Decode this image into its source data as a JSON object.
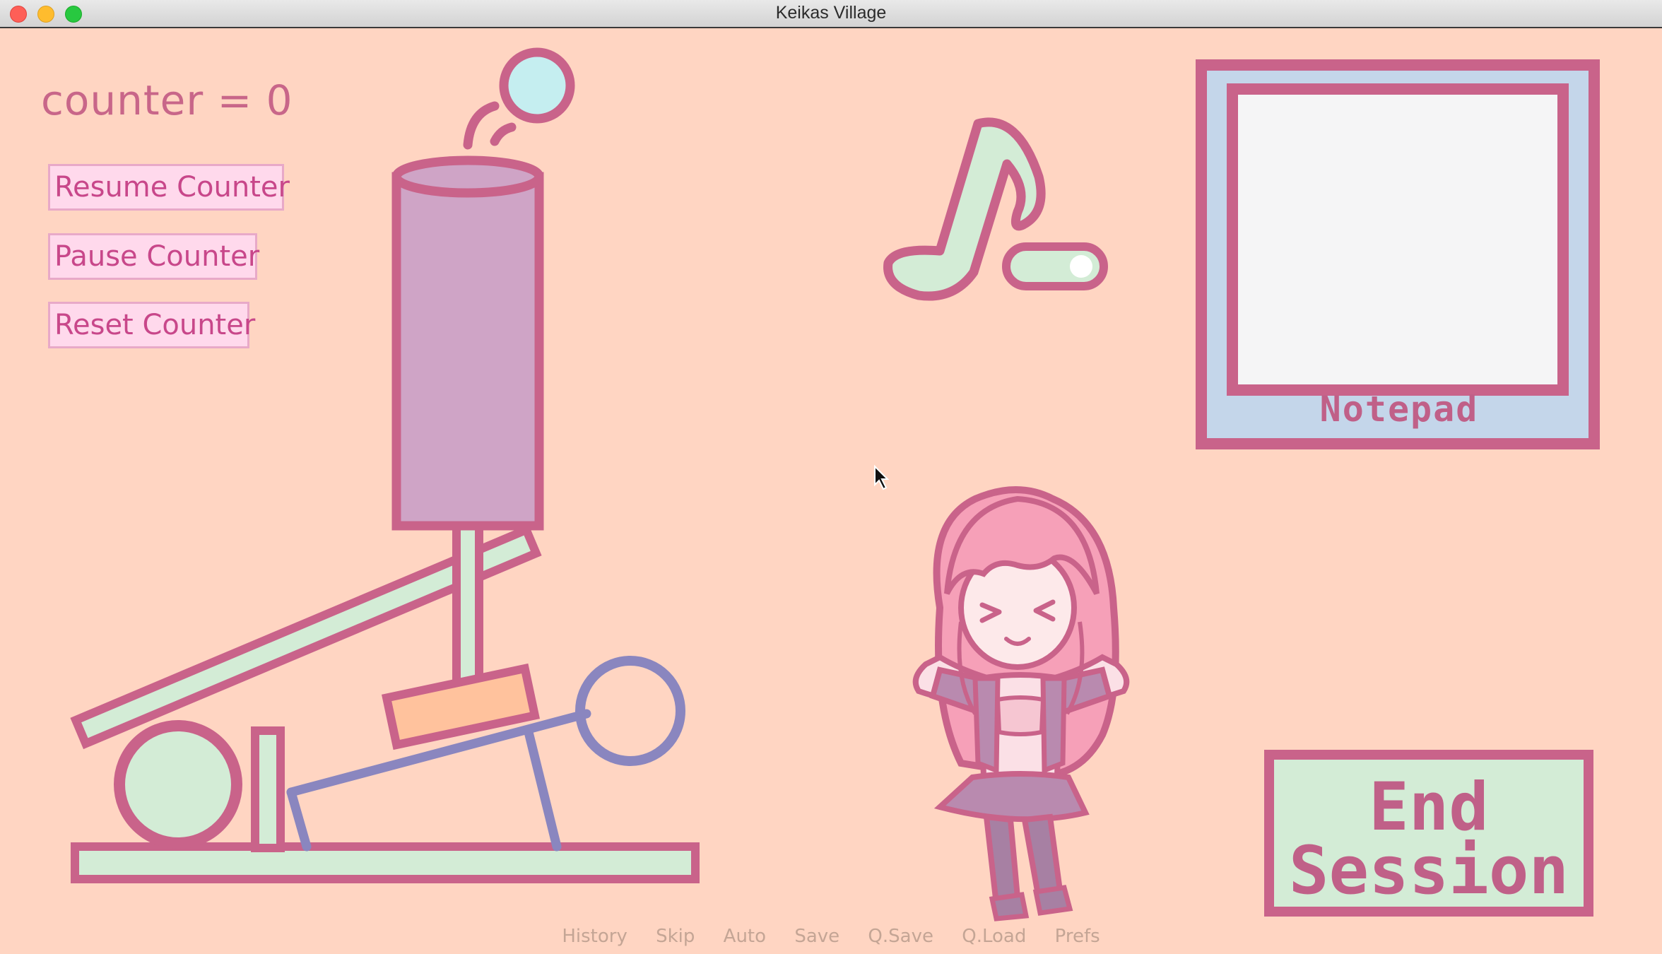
{
  "window": {
    "title": "Keikas Village"
  },
  "counter": {
    "label": "counter = 0",
    "buttons": {
      "resume": "Resume Counter",
      "pause": "Pause Counter",
      "reset": "Reset Counter"
    }
  },
  "music": {
    "icon": "music-note-icon",
    "toggle": "on"
  },
  "notepad": {
    "label": "Notepad"
  },
  "end_session": {
    "line1": "End",
    "line2": "Session"
  },
  "quick_menu": [
    "History",
    "Skip",
    "Auto",
    "Save",
    "Q.Save",
    "Q.Load",
    "Prefs"
  ],
  "colors": {
    "background": "#ffd5c2",
    "outline": "#c9638a",
    "mint": "#d3ecd6",
    "lavender": "#cfa4c6",
    "periwinkle": "#8a86bf",
    "sky": "#c4d6ea",
    "cyan": "#c5eef0",
    "text_pink": "#c8478a"
  }
}
